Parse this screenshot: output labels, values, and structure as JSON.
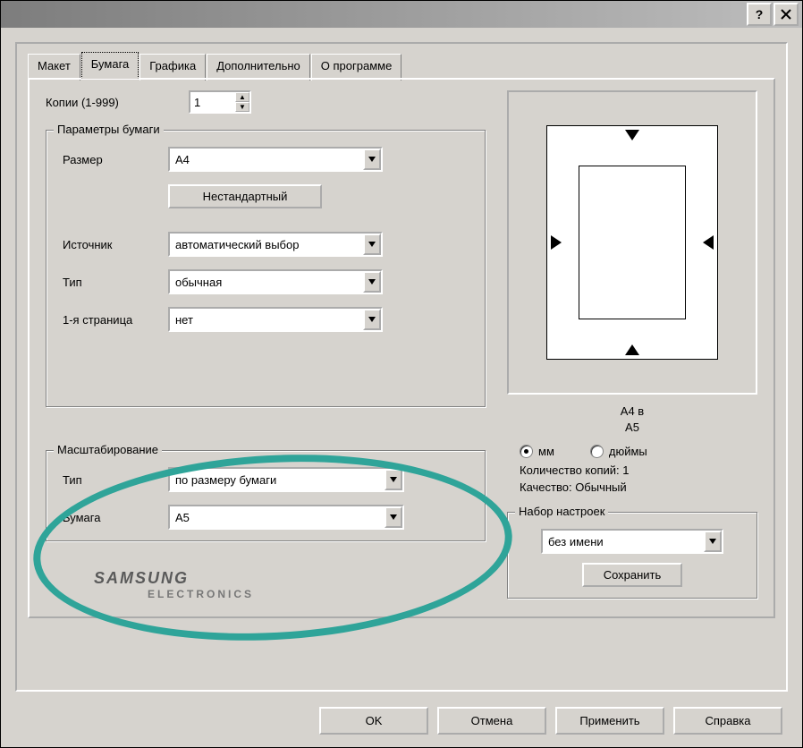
{
  "titlebar": {
    "help_icon": "?",
    "close_icon": "×"
  },
  "tabs": {
    "items": [
      {
        "label": "Макет"
      },
      {
        "label": "Бумага"
      },
      {
        "label": "Графика"
      },
      {
        "label": "Дополнительно"
      },
      {
        "label": "О программе"
      }
    ],
    "active_index": 1
  },
  "copies": {
    "label": "Копии (1-999)",
    "value": "1"
  },
  "paper_group": {
    "legend": "Параметры бумаги",
    "size_label": "Размер",
    "size_value": "A4",
    "custom_btn": "Нестандартный",
    "source_label": "Источник",
    "source_value": "автоматический выбор",
    "type_label": "Тип",
    "type_value": "обычная",
    "firstpage_label": "1-я страница",
    "firstpage_value": "нет"
  },
  "scaling_group": {
    "legend": "Масштабирование",
    "type_label": "Тип",
    "type_value": "по размеру бумаги",
    "paper_label": "Бумага",
    "paper_value": "A5"
  },
  "preview": {
    "line1": "A4 в",
    "line2": "A5",
    "unit_mm": "мм",
    "unit_in": "дюймы",
    "copies_label": "Количество копий: 1",
    "quality_label": "Качество: Обычный"
  },
  "preset_group": {
    "legend": "Набор настроек",
    "value": "без имени",
    "save_btn": "Сохранить"
  },
  "brand": {
    "name": "SAMSUNG",
    "sub": "ELECTRONICS"
  },
  "buttons": {
    "ok": "OK",
    "cancel": "Отмена",
    "apply": "Применить",
    "help": "Справка"
  }
}
